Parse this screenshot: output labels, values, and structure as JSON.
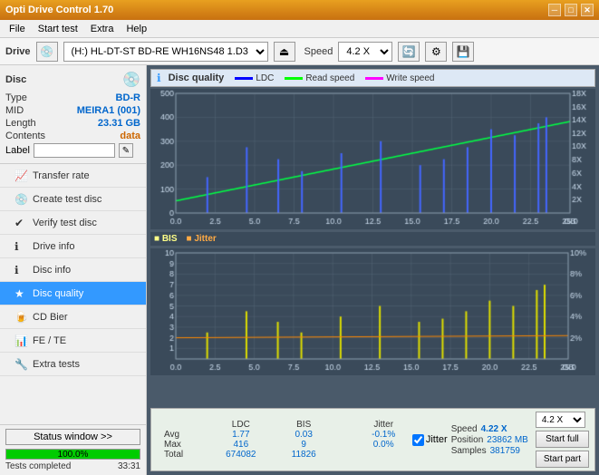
{
  "app": {
    "title": "Opti Drive Control 1.70",
    "title_icon": "💿"
  },
  "title_controls": {
    "minimize": "─",
    "maximize": "□",
    "close": "✕"
  },
  "menu": {
    "items": [
      "File",
      "Start test",
      "Extra",
      "Help"
    ]
  },
  "toolbar": {
    "drive_label": "Drive",
    "drive_value": "(H:)  HL-DT-ST BD-RE  WH16NS48 1.D3",
    "speed_label": "Speed",
    "speed_value": "4.2 X"
  },
  "disc": {
    "section_label": "Disc",
    "fields": [
      {
        "label": "Type",
        "value": "BD-R",
        "class": "blue"
      },
      {
        "label": "MID",
        "value": "MEIRA1 (001)",
        "class": "blue"
      },
      {
        "label": "Length",
        "value": "23.31 GB",
        "class": "blue"
      },
      {
        "label": "Contents",
        "value": "data",
        "class": "orange"
      }
    ],
    "label_label": "Label",
    "label_placeholder": ""
  },
  "nav": {
    "items": [
      {
        "id": "transfer-rate",
        "icon": "📈",
        "label": "Transfer rate",
        "active": false
      },
      {
        "id": "create-test-disc",
        "icon": "💿",
        "label": "Create test disc",
        "active": false
      },
      {
        "id": "verify-test-disc",
        "icon": "✔",
        "label": "Verify test disc",
        "active": false
      },
      {
        "id": "drive-info",
        "icon": "ℹ",
        "label": "Drive info",
        "active": false
      },
      {
        "id": "disc-info",
        "icon": "ℹ",
        "label": "Disc info",
        "active": false
      },
      {
        "id": "disc-quality",
        "icon": "★",
        "label": "Disc quality",
        "active": true
      },
      {
        "id": "cd-bier",
        "icon": "🍺",
        "label": "CD Bier",
        "active": false
      },
      {
        "id": "fe-te",
        "icon": "📊",
        "label": "FE / TE",
        "active": false
      },
      {
        "id": "extra-tests",
        "icon": "🔧",
        "label": "Extra tests",
        "active": false
      }
    ]
  },
  "status": {
    "window_btn": "Status window >>",
    "progress_pct": 100,
    "progress_text": "100.0%",
    "status_text": "Tests completed",
    "time": "33:31"
  },
  "chart": {
    "title_icon": "ℹ",
    "title": "Disc quality",
    "legend": [
      {
        "label": "LDC",
        "color": "#4444ff"
      },
      {
        "label": "Read speed",
        "color": "#00cc00"
      },
      {
        "label": "Write speed",
        "color": "#ff44ff"
      }
    ],
    "top_y_max": 500,
    "top_y_labels": [
      500,
      400,
      300,
      200,
      100
    ],
    "top_y2_labels": [
      "18X",
      "16X",
      "14X",
      "12X",
      "10X",
      "8X",
      "6X",
      "4X",
      "2X"
    ],
    "bottom_y_max": 10,
    "bottom_legend": [
      {
        "label": "BIS",
        "color": "#ffff00"
      },
      {
        "label": "Jitter",
        "color": "#ff8800"
      }
    ],
    "x_labels": [
      "0.0",
      "2.5",
      "5.0",
      "7.5",
      "10.0",
      "12.5",
      "15.0",
      "17.5",
      "20.0",
      "22.5",
      "25.0"
    ],
    "x_unit": "GB"
  },
  "stats": {
    "columns": [
      "LDC",
      "BIS",
      "",
      "Jitter",
      "Speed",
      ""
    ],
    "avg_label": "Avg",
    "avg_ldc": "1.77",
    "avg_bis": "0.03",
    "avg_jitter": "-0.1%",
    "max_label": "Max",
    "max_ldc": "416",
    "max_bis": "9",
    "max_jitter": "0.0%",
    "total_label": "Total",
    "total_ldc": "674082",
    "total_bis": "11826",
    "jitter_label": "Jitter",
    "speed_label": "Speed",
    "speed_value": "4.22 X",
    "position_label": "Position",
    "position_value": "23862 MB",
    "samples_label": "Samples",
    "samples_value": "381759",
    "speed_dropdown": "4.2 X",
    "btn_start_full": "Start full",
    "btn_start_part": "Start part"
  }
}
